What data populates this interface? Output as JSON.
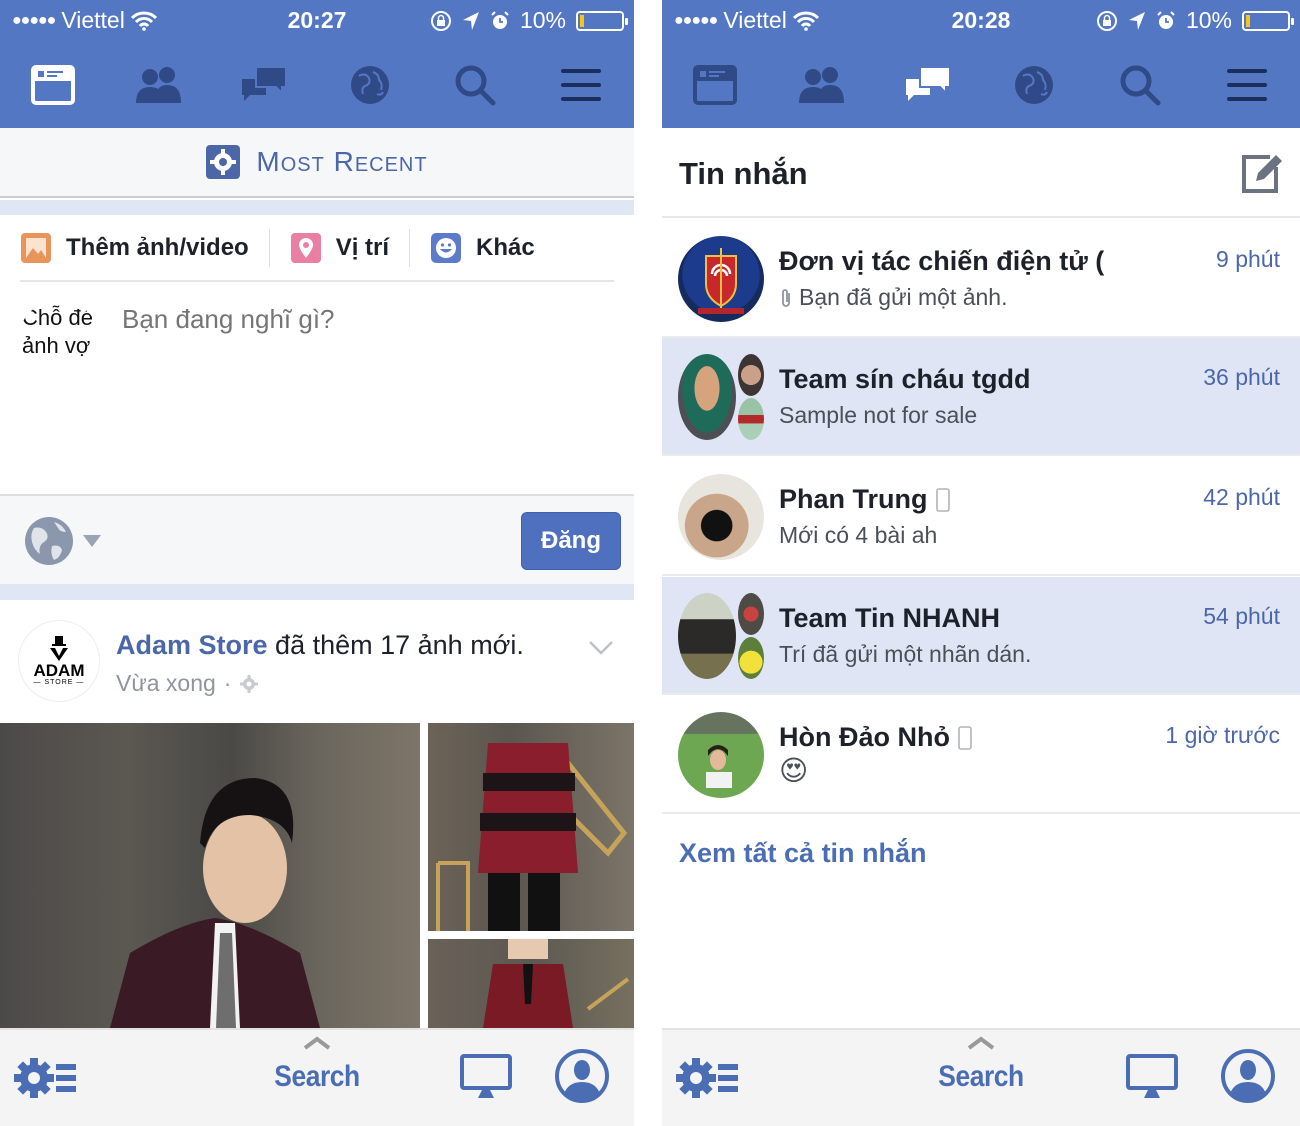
{
  "colors": {
    "brand_blue": "#5477c4",
    "link_blue": "#4b67a8",
    "unread_bg": "#dfe5f5",
    "battery_level": "#f5c518"
  },
  "left_screen": {
    "status_bar": {
      "signal_icon": "signal-dots",
      "carrier": "Viettel",
      "wifi_icon": "wifi-icon",
      "time": "20:27",
      "battery_percent": "10%",
      "battery_fraction": 0.1
    },
    "nav": {
      "active": "news-feed",
      "items": [
        "news-feed",
        "friend-requests",
        "messages",
        "notifications",
        "search",
        "menu"
      ]
    },
    "feed_filter": {
      "icon": "gear-icon",
      "label": "Most Recent"
    },
    "composer": {
      "actions": [
        {
          "icon": "photo-icon",
          "label": "Thêm ảnh/video"
        },
        {
          "icon": "location-pin-icon",
          "label": "Vị trí"
        },
        {
          "icon": "smiley-icon",
          "label": "Khác"
        }
      ],
      "avatar_text_line1": "Chỗ đé",
      "avatar_text_line2": "ảnh vợ",
      "placeholder": "Bạn đang nghĩ gì?",
      "privacy": "public-globe",
      "post_label": "Đăng"
    },
    "story": {
      "page_logo_brand": "ADAM",
      "page_logo_sub": "— STORE —",
      "actor": "Adam Store",
      "action": " đã thêm 17 ảnh mới.",
      "time": "Vừa xong",
      "separator": "·",
      "photos": [
        "Man in burgundy suit portrait",
        "Man in red and black striped coat",
        "Man in burgundy blazer"
      ]
    },
    "bottom_bar": {
      "search_label": "Search"
    }
  },
  "right_screen": {
    "status_bar": {
      "signal_icon": "signal-dots",
      "carrier": "Viettel",
      "wifi_icon": "wifi-icon",
      "time": "20:28",
      "battery_percent": "10%",
      "battery_fraction": 0.1
    },
    "nav": {
      "active": "messages",
      "items": [
        "news-feed",
        "friend-requests",
        "messages",
        "notifications",
        "search",
        "menu"
      ]
    },
    "messages": {
      "title": "Tin nhắn",
      "threads": [
        {
          "name": "Đơn vị tác chiến điện tử (",
          "snippet": "Bạn đã gửi một ảnh.",
          "has_attachment": true,
          "time": "9 phút",
          "unread": false,
          "group": false,
          "mobile": false
        },
        {
          "name": "Team sín cháu tgdd",
          "snippet": "Sample not for sale",
          "has_attachment": false,
          "time": "36 phút",
          "unread": true,
          "group": true,
          "mobile": false
        },
        {
          "name": "Phan Trung",
          "snippet": "Mới có 4 bài ah",
          "has_attachment": false,
          "time": "42 phút",
          "unread": false,
          "group": false,
          "mobile": true
        },
        {
          "name": "Team Tin NHANH",
          "snippet": "Trí đã gửi một nhãn dán.",
          "has_attachment": false,
          "time": "54 phút",
          "unread": true,
          "group": true,
          "mobile": false
        },
        {
          "name": "Hòn Đảo Nhỏ",
          "snippet": "😍",
          "has_attachment": false,
          "time": "1 giờ trước",
          "unread": false,
          "group": false,
          "mobile": true
        }
      ],
      "see_all": "Xem tất cả tin nhắn"
    },
    "bottom_bar": {
      "search_label": "Search"
    }
  }
}
